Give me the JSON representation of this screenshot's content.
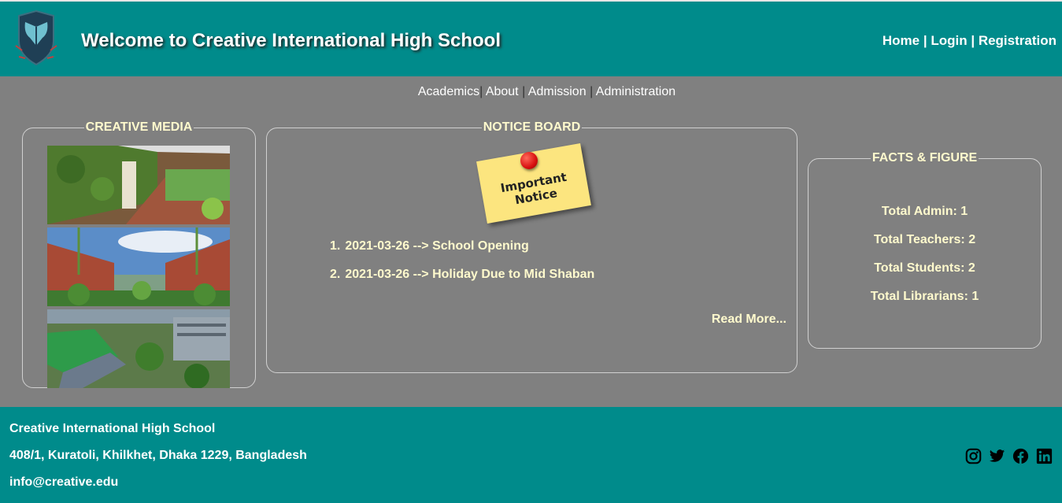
{
  "header": {
    "title": "Welcome to Creative International High School",
    "nav": [
      {
        "label": "Home"
      },
      {
        "label": "Login"
      },
      {
        "label": "Registration"
      }
    ],
    "nav_separator": "|"
  },
  "sub_nav": {
    "items": [
      {
        "label": "Academics"
      },
      {
        "label": "About"
      },
      {
        "label": "Admission"
      },
      {
        "label": "Administration"
      }
    ],
    "separator": "|"
  },
  "media": {
    "legend": "CREATIVE MEDIA",
    "photos": [
      "campus-walkway-photo",
      "school-building-courtyard-photo",
      "aerial-campus-garden-photo"
    ]
  },
  "notice_board": {
    "legend": "NOTICE BOARD",
    "sticky_note": "Important Notice",
    "notices": [
      {
        "index": "1.",
        "date": "2021-03-26",
        "arrow": "-->",
        "title": "School Opening"
      },
      {
        "index": "2.",
        "date": "2021-03-26",
        "arrow": "-->",
        "title": "Holiday Due to Mid Shaban"
      }
    ],
    "read_more": "Read More..."
  },
  "facts": {
    "legend": "FACTS & FIGURE",
    "items": [
      {
        "label": "Total Admin: 1"
      },
      {
        "label": "Total Teachers: 2"
      },
      {
        "label": "Total Students: 2"
      },
      {
        "label": "Total Librarians: 1"
      }
    ]
  },
  "footer": {
    "name": "Creative International High School",
    "address": "408/1, Kuratoli, Khilkhet, Dhaka 1229, Bangladesh",
    "email": "info@creative.edu",
    "social_icons": [
      "instagram-icon",
      "twitter-icon",
      "facebook-icon",
      "linkedin-icon"
    ]
  },
  "colors": {
    "header_bg": "#008b8b",
    "page_bg": "#808080",
    "accent_text": "#fffacd"
  }
}
